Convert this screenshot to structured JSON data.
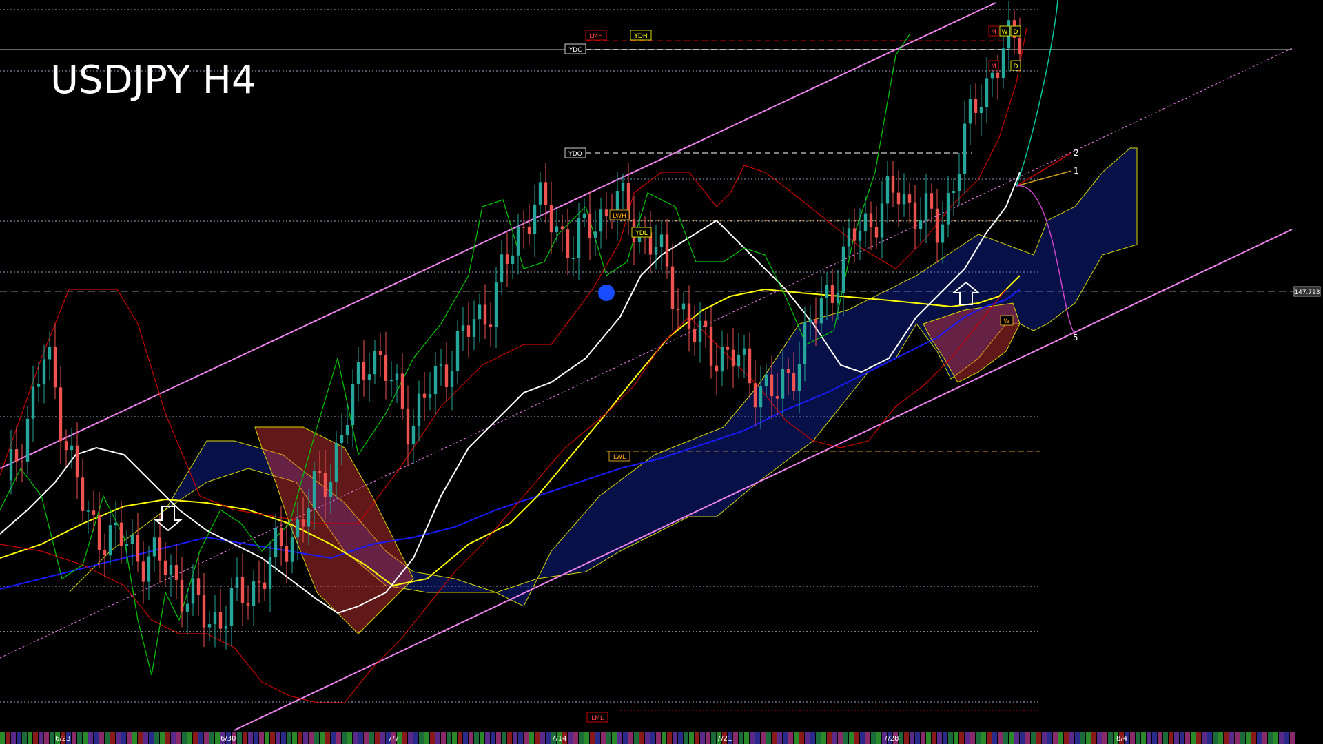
{
  "title": "USDJPY H4",
  "price_tag": "147.793",
  "level_tags": {
    "lmh": "LMH",
    "ydh": "YDH",
    "ydc": "YDC",
    "ydo": "YDO",
    "lwh": "LWH",
    "ydl": "YDL",
    "lwl": "LWL",
    "lml": "LML",
    "m": "M",
    "w": "W",
    "d": "D"
  },
  "wave_labels": [
    "2",
    "1",
    "5"
  ],
  "date_labels": [
    "6/23",
    "6/30",
    "7/7",
    "7/14",
    "7/21",
    "7/28",
    "8/4"
  ],
  "colors": {
    "background": "#000000",
    "bull_candle": "#26a69a",
    "bear_candle": "#ef5350",
    "channel": "#ee82ee",
    "ma_white": "#ffffff",
    "ma_yellow": "#ffff00",
    "ma_blue": "#0000ff",
    "bollinger": "#cc0000",
    "chikou": "#00cc00",
    "kumo_bull": "#1e3cff",
    "kumo_bear": "#ff4040"
  },
  "chart_data": {
    "type": "candlestick",
    "title": "USDJPY H4",
    "xlabel": "",
    "ylabel": "",
    "grid": false,
    "x_tick_labels": [
      "6/23",
      "6/30",
      "7/7",
      "7/14",
      "7/21",
      "7/28",
      "8/4"
    ],
    "current_price": 147.793,
    "path_keypoints": [
      {
        "date": "6/23",
        "close": 144.6
      },
      {
        "date": "6/24",
        "close": 146.4
      },
      {
        "date": "6/25",
        "close": 144.2
      },
      {
        "date": "6/27",
        "close": 143.9
      },
      {
        "date": "6/30",
        "close": 143.6
      },
      {
        "date": "7/1",
        "close": 142.9
      },
      {
        "date": "7/2",
        "close": 143.3
      },
      {
        "date": "7/4",
        "close": 144.0
      },
      {
        "date": "7/7",
        "close": 144.9
      },
      {
        "date": "7/9",
        "close": 146.5
      },
      {
        "date": "7/10",
        "close": 145.5
      },
      {
        "date": "7/11",
        "close": 146.4
      },
      {
        "date": "7/14",
        "close": 147.1
      },
      {
        "date": "7/15",
        "close": 148.4
      },
      {
        "date": "7/16",
        "close": 147.8
      },
      {
        "date": "7/18",
        "close": 148.4
      },
      {
        "date": "7/21",
        "close": 147.8
      },
      {
        "date": "7/22",
        "close": 146.6
      },
      {
        "date": "7/23",
        "close": 146.3
      },
      {
        "date": "7/24",
        "close": 145.8
      },
      {
        "date": "7/25",
        "close": 146.9
      },
      {
        "date": "7/28",
        "close": 148.0
      },
      {
        "date": "7/29",
        "close": 148.5
      },
      {
        "date": "7/30",
        "close": 148.0
      },
      {
        "date": "7/31",
        "close": 149.8
      },
      {
        "date": "8/1",
        "close": 150.6
      }
    ]
  }
}
